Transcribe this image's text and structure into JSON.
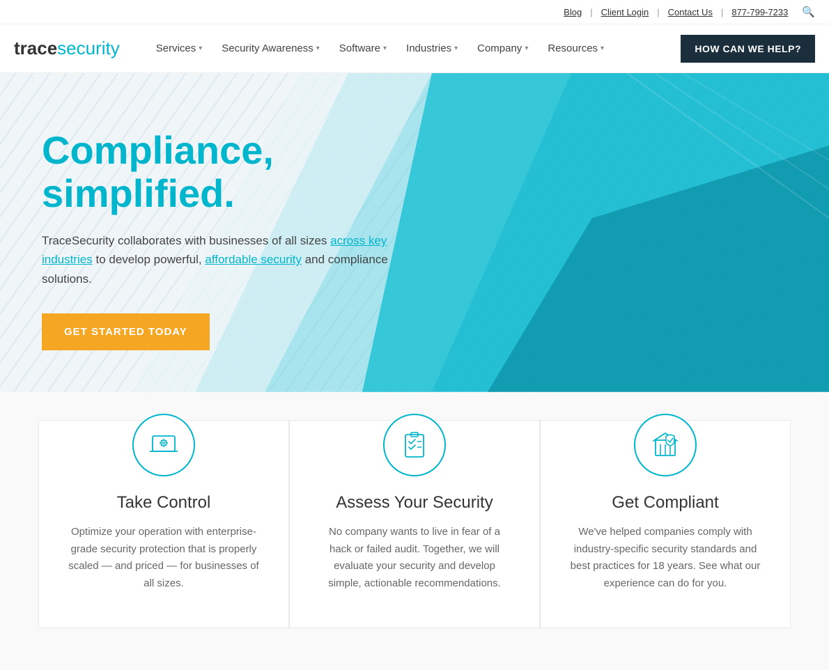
{
  "topbar": {
    "blog": "Blog",
    "client_login": "Client Login",
    "contact_us": "Contact Us",
    "phone": "877-799-7233"
  },
  "nav": {
    "logo_trace": "trace",
    "logo_security": "security",
    "items": [
      {
        "label": "Services",
        "id": "services"
      },
      {
        "label": "Security Awareness",
        "id": "security-awareness"
      },
      {
        "label": "Software",
        "id": "software"
      },
      {
        "label": "Industries",
        "id": "industries"
      },
      {
        "label": "Company",
        "id": "company"
      },
      {
        "label": "Resources",
        "id": "resources"
      }
    ],
    "cta": "HOW CAN WE HELP?"
  },
  "hero": {
    "heading": "Compliance, simplified.",
    "body_start": "TraceSecurity collaborates with businesses of all sizes ",
    "link1_text": "across key industries",
    "body_mid": " to develop powerful, ",
    "link2_text": "affordable security",
    "body_end": " and compliance solutions.",
    "cta_button": "GET STARTED TODAY"
  },
  "cards": [
    {
      "id": "take-control",
      "title": "Take Control",
      "description": "Optimize your operation with enterprise-grade security protection that is properly scaled — and priced — for businesses of all sizes.",
      "icon": "laptop-gear"
    },
    {
      "id": "assess-security",
      "title": "Assess Your Security",
      "description": "No company wants to live in fear of a hack or failed audit. Together, we will evaluate your security and develop simple, actionable recommendations.",
      "icon": "checklist"
    },
    {
      "id": "get-compliant",
      "title": "Get Compliant",
      "description": "We've helped companies comply with industry-specific security standards and best practices for 18 years. See what our experience can do for you.",
      "icon": "building-shield"
    }
  ]
}
